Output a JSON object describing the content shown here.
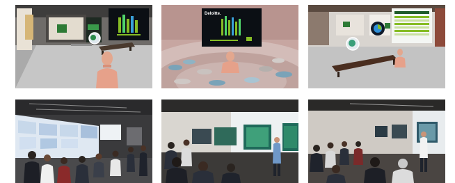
{
  "tiles": [
    {
      "id": "vr-atrium-wall-screen",
      "kind": "virtual"
    },
    {
      "id": "vr-amphitheater-screen",
      "kind": "virtual",
      "screen_text": "Deloitte."
    },
    {
      "id": "vr-gallery-dashboard",
      "kind": "virtual"
    },
    {
      "id": "physical-video-wall-audience",
      "kind": "photo"
    },
    {
      "id": "physical-screens-presenter",
      "kind": "photo"
    },
    {
      "id": "physical-room-presenter",
      "kind": "photo"
    }
  ],
  "colors": {
    "accent_green": "#86bc25",
    "screen_dark": "#0b0f14",
    "floor_gray": "#b9b9b9"
  }
}
